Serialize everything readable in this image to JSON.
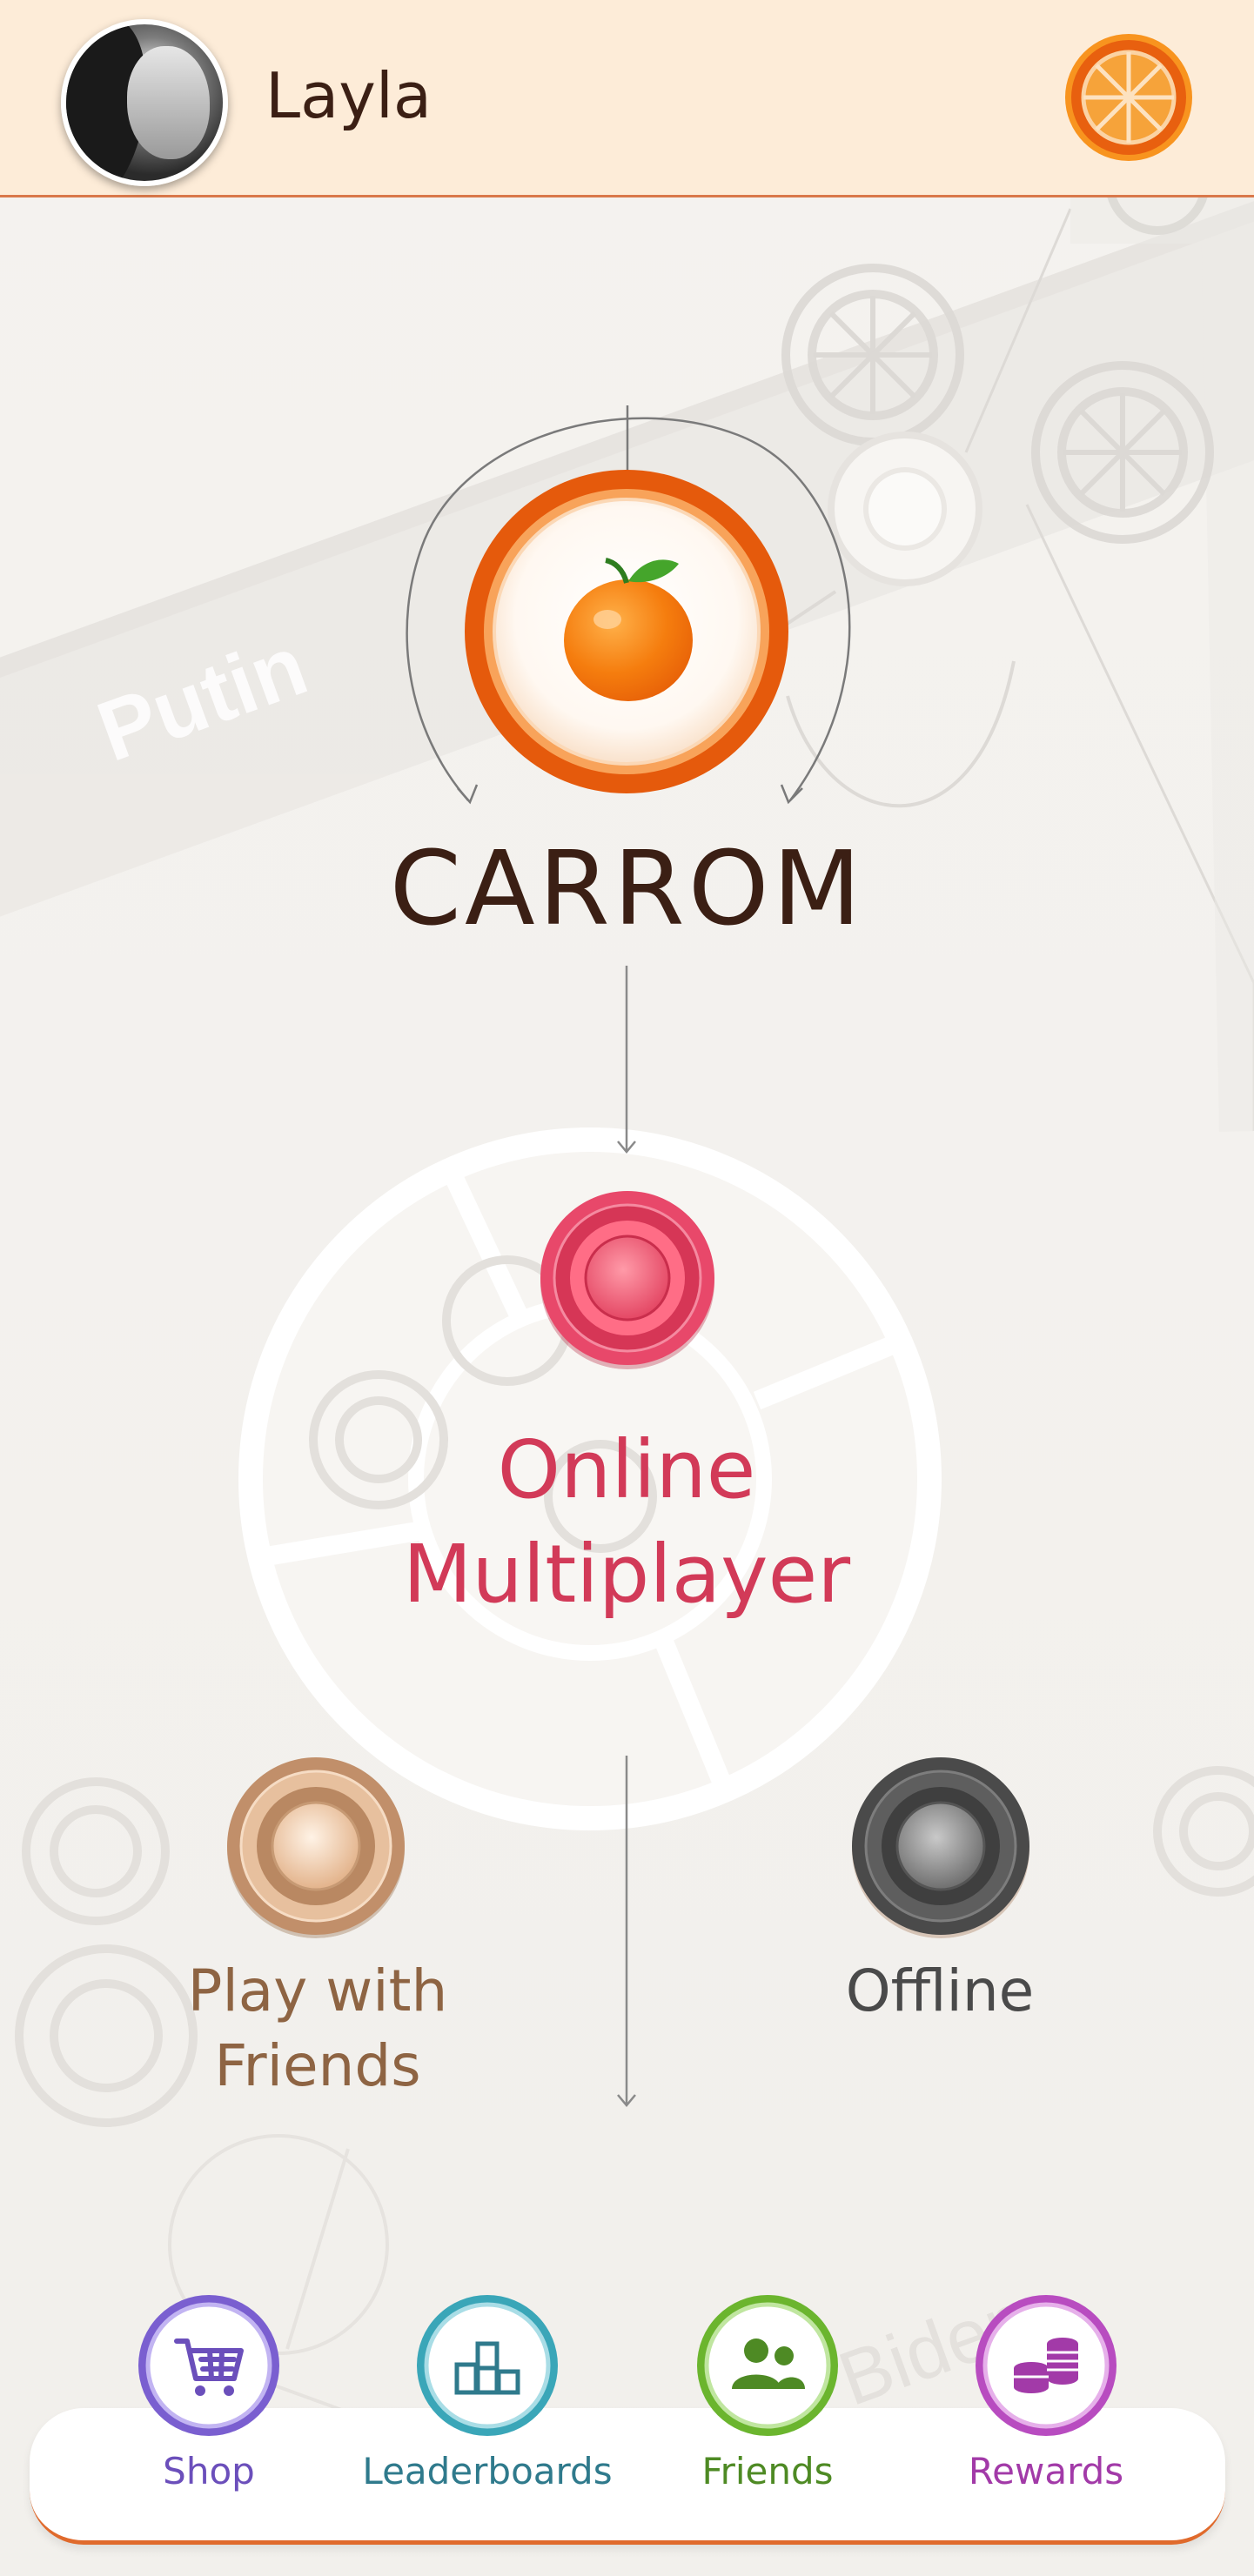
{
  "header": {
    "username": "Layla"
  },
  "background": {
    "board_label_left": "Putin",
    "board_label_right": "Biden"
  },
  "game": {
    "title": "CARROM"
  },
  "modes": {
    "online": {
      "label_line1": "Online",
      "label_line2": "Multiplayer",
      "color": "#d23a58"
    },
    "friends": {
      "label_line1": "Play with",
      "label_line2": "Friends",
      "color": "#8e6443"
    },
    "offline": {
      "label": "Offline",
      "color": "#4a4a4a"
    }
  },
  "nav": {
    "shop": {
      "label": "Shop",
      "color": "#6b4fbb",
      "icon": "cart-icon"
    },
    "leaderboards": {
      "label": "Leaderboards",
      "color": "#2f7a8c",
      "icon": "podium-icon"
    },
    "friends": {
      "label": "Friends",
      "color": "#4e8a24",
      "icon": "people-icon"
    },
    "rewards": {
      "label": "Rewards",
      "color": "#a23aa8",
      "icon": "coins-icon"
    }
  },
  "colors": {
    "accent": "#e8600f",
    "header_bg": "#fdecd8",
    "title": "#3b1f14"
  }
}
